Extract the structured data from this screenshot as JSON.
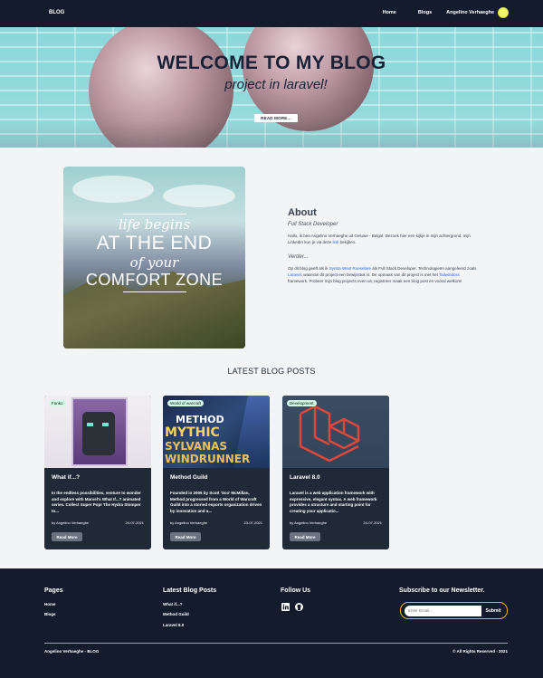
{
  "nav": {
    "brand": "BLOG",
    "home": "Home",
    "blogs": "Blogs",
    "user": "Angelino Verhaeghe"
  },
  "hero": {
    "title": "WELCOME TO MY BLOG",
    "subtitle": "project in laravel!",
    "button": "READ MORE..."
  },
  "about_image": {
    "line1": "life begins",
    "line2": "AT THE END",
    "line3": "of your",
    "line4": "COMFORT ZONE"
  },
  "about": {
    "heading": "About",
    "role": "Full Stack Developer",
    "intro_pre": "Hallo, ik ben Angelino Verhaeghe uit Geluwe - België. Bezoek hier een kijkje in mijn achtergrond, mijn LinkedIn kun je via deze ",
    "intro_link": "link",
    "intro_post": " bekijken.",
    "more_heading": "Verder...",
    "more_pre": "Op dit blog geeft als ik ",
    "more_link1": "Syntra West Roeselare",
    "more_mid1": " als Full Stack Developer. Technologieën aangeleerd zoals ",
    "more_link2": "Laravel",
    "more_mid2": ", waarvan dit project een bewijsstuk is. De opmaak van dit project is met het ",
    "more_link3": "Tailwindcss",
    "more_post": " framework. Probeer mijn blog projects even uit, registreer maak een blog post en vooral welkom!"
  },
  "latest_title": "LATEST BLOG POSTS",
  "posts": [
    {
      "badge": "Funko",
      "title": "What if...?",
      "desc": "In the endless possibilities, venture to wonder and explore with Marvel's What If...? animated series. Collect Super Pop! The Hydra Stomper to...",
      "author": "by Angelino Verhaeghe",
      "date": "24-07-2021",
      "button": "Read More"
    },
    {
      "badge": "World of warcraft",
      "title": "Method Guild",
      "desc": "Founded in 2005 by Scott 'Sco' McMillan, Method progressed from a World of Warcraft Guild into a storied esports organization driven by innovation and a...",
      "author": "by Angelino Verhaeghe",
      "date": "23-07-2021",
      "button": "Read More",
      "img_text": [
        "METHOD",
        "MYTHIC",
        "SYLVANAS",
        "WINDRUNNER"
      ]
    },
    {
      "badge": "Development",
      "title": "Laravel 8.0",
      "desc": "Laravel is a web application framework with expressive, elegant syntax. A web framework provides a structure and starting point for creating your applicatio...",
      "author": "by Angelino Verhaeghe",
      "date": "24-07-2021",
      "button": "Read More"
    }
  ],
  "footer": {
    "pages_heading": "Pages",
    "pages": [
      "Home",
      "Blogs"
    ],
    "latest_heading": "Latest Blog Posts",
    "latest": [
      "What if...?",
      "Method Guild",
      "Laravel 8.0"
    ],
    "follow_heading": "Follow Us",
    "social": [
      "linkedin-icon",
      "github-icon"
    ],
    "newsletter_heading": "Subscribe to our Newsletter.",
    "email_placeholder": "Enter Email...",
    "submit": "Submit",
    "copy_left": "Angelino Verhaeghe - BLOG",
    "copy_right": "© All Rights Reserved - 2021"
  },
  "colors": {
    "nav_bg": "#141b2d",
    "card_bg": "#1f2937",
    "badge_bg": "#d1fae5",
    "accent_yellow": "#eab308",
    "link_blue": "#2563eb"
  }
}
